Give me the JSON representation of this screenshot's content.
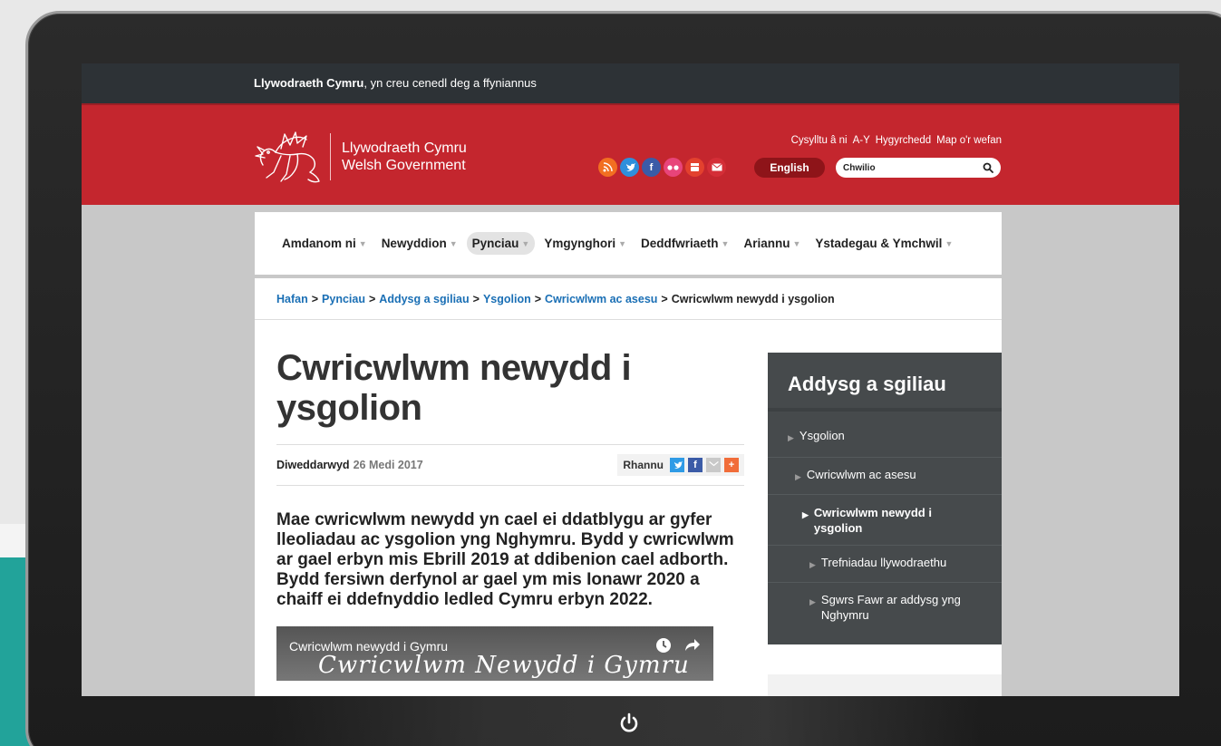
{
  "top_bar": {
    "brand": "Llywodraeth Cymru",
    "tagline": ", yn creu cenedl deg a ffyniannus"
  },
  "header": {
    "logo_line1": "Llywodraeth Cymru",
    "logo_line2": "Welsh Government",
    "top_links": [
      "Cysylltu â ni",
      "A-Y",
      "Hygyrchedd",
      "Map o'r wefan"
    ],
    "social_icons": [
      "rss-icon",
      "twitter-icon",
      "facebook-icon",
      "flickr-icon",
      "youtube-icon",
      "email-icon"
    ],
    "language_button": "English",
    "search_value": "Chwilio",
    "brand_color": "#c4262e"
  },
  "nav": {
    "items": [
      {
        "label": "Amdanom ni"
      },
      {
        "label": "Newyddion"
      },
      {
        "label": "Pynciau"
      },
      {
        "label": "Ymgynghori"
      },
      {
        "label": "Deddfwriaeth"
      },
      {
        "label": "Ariannu"
      },
      {
        "label": "Ystadegau & Ymchwil"
      }
    ]
  },
  "breadcrumb": {
    "links": [
      "Hafan",
      "Pynciau",
      "Addysg a sgiliau",
      "Ysgolion",
      "Cwricwlwm ac asesu"
    ],
    "current": "Cwricwlwm newydd i ysgolion"
  },
  "article": {
    "title": "Cwricwlwm newydd i ysgolion",
    "updated_label": "Diweddarwyd",
    "updated_date": "26 Medi 2017",
    "share_label": "Rhannu",
    "summary": "Mae cwricwlwm newydd yn cael ei ddatblygu ar gyfer lleoliadau ac ysgolion yng Nghymru. Bydd y cwricwlwm ar gael erbyn mis Ebrill 2019 at ddibenion cael adborth. Bydd fersiwn derfynol ar gael ym mis Ionawr 2020 a chaiff ei ddefnyddio ledled Cymru erbyn 2022.",
    "video_title": "Cwricwlwm newydd i Gymru",
    "video_script": "Cwricwlwm Newydd i Gymru"
  },
  "sidebar": {
    "title": "Addysg a sgiliau",
    "items": [
      {
        "label": "Ysgolion"
      },
      {
        "label": "Cwricwlwm ac asesu"
      },
      {
        "label": "Cwricwlwm newydd i ysgolion"
      },
      {
        "label": "Trefniadau llywodraethu"
      },
      {
        "label": "Sgwrs Fawr ar addysg yng Nghymru"
      }
    ]
  }
}
